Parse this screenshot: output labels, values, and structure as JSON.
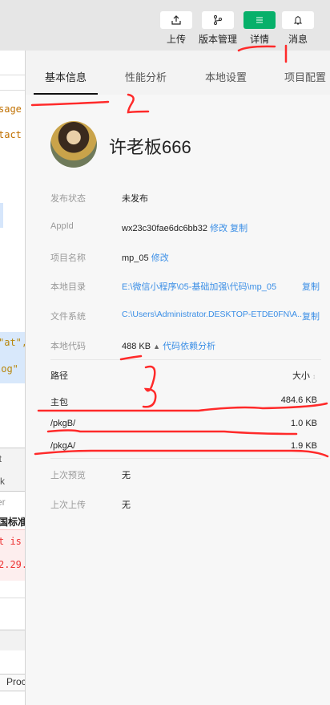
{
  "toolbar": {
    "buttons": [
      {
        "label": "上传",
        "icon": "upload-icon"
      },
      {
        "label": "版本管理",
        "icon": "branch-icon"
      },
      {
        "label": "详情",
        "icon": "menu-icon",
        "active": true
      },
      {
        "label": "消息",
        "icon": "bell-icon"
      }
    ]
  },
  "editor": {
    "lines": [
      "sage",
      "tact",
      "\"at\",",
      "log\""
    ],
    "panel_items": [
      "it",
      "rk"
    ],
    "filter_placeholder": "er",
    "console_title": "国标准",
    "errors": [
      "t is n",
      "2.29."
    ],
    "table_header": "Proc"
  },
  "tabs": [
    "基本信息",
    "性能分析",
    "本地设置",
    "项目配置"
  ],
  "profile": {
    "name": "许老板666"
  },
  "info": {
    "publish_status": {
      "label": "发布状态",
      "value": "未发布"
    },
    "appid": {
      "label": "AppId",
      "value": "wx23c30fae6dc6bb32",
      "edit": "修改",
      "copy": "复制"
    },
    "project_name": {
      "label": "项目名称",
      "value": "mp_05",
      "edit": "修改"
    },
    "local_dir": {
      "label": "本地目录",
      "value": "E:\\微信小程序\\05-基础加强\\代码\\mp_05",
      "copy": "复制"
    },
    "file_system": {
      "label": "文件系统",
      "value": "C:\\Users\\Administrator.DESKTOP-ETDE0FN\\A...",
      "copy": "复制"
    },
    "local_code": {
      "label": "本地代码",
      "value": "488 KB",
      "link": "代码依赖分析"
    }
  },
  "packages": {
    "header_path": "路径",
    "header_size": "大小",
    "rows": [
      {
        "path": "主包",
        "size": "484.6 KB"
      },
      {
        "path": "/pkgB/",
        "size": "1.0 KB"
      },
      {
        "path": "/pkgA/",
        "size": "1.9 KB"
      }
    ]
  },
  "last_preview": {
    "label": "上次预览",
    "value": "无"
  },
  "last_upload": {
    "label": "上次上传",
    "value": "无"
  },
  "colors": {
    "accent": "#07b06a",
    "link": "#3a8ee6",
    "annotation": "#ff2a2a"
  }
}
